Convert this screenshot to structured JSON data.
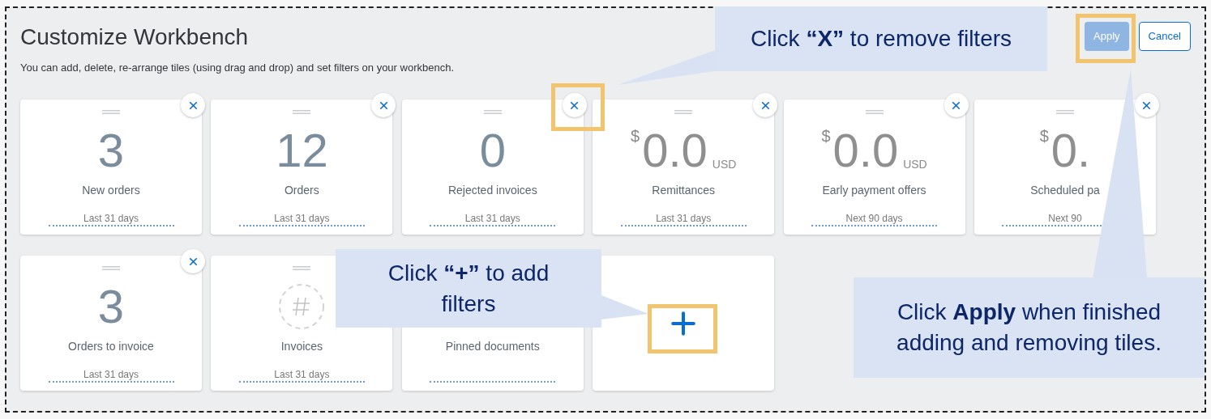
{
  "header": {
    "title": "Customize Workbench",
    "subtitle": "You can add, delete, re-arrange tiles (using drag and drop) and set filters on your workbench."
  },
  "buttons": [
    {
      "label": "Apply",
      "kind": "primary"
    },
    {
      "label": "Cancel",
      "kind": "secondary"
    }
  ],
  "tiles": [
    {
      "kind": "count",
      "value": "3",
      "label": "New orders",
      "period": "Last 31 days",
      "removable": true
    },
    {
      "kind": "count",
      "value": "12",
      "label": "Orders",
      "period": "Last 31 days",
      "removable": true
    },
    {
      "kind": "count",
      "value": "0",
      "label": "Rejected invoices",
      "period": "Last 31 days",
      "removable": true
    },
    {
      "kind": "amount",
      "currency_symbol": "$",
      "value": "0.0",
      "currency": "USD",
      "label": "Remittances",
      "period": "Last 31 days",
      "removable": true
    },
    {
      "kind": "amount",
      "currency_symbol": "$",
      "value": "0.0",
      "currency": "USD",
      "label": "Early payment offers",
      "period": "Next 90 days",
      "removable": true
    },
    {
      "kind": "amount",
      "currency_symbol": "$",
      "value": "0.",
      "label": "Scheduled pa",
      "period": "Next 90",
      "removable": true
    },
    {
      "kind": "count",
      "value": "3",
      "label": "Orders to invoice",
      "period": "Last 31 days",
      "removable": true
    },
    {
      "kind": "placeholder",
      "label": "Invoices",
      "period": "Last 31 days",
      "removable": false
    },
    {
      "kind": "empty",
      "label": "Pinned documents"
    },
    {
      "kind": "add"
    }
  ],
  "callouts": [
    {
      "kind": "remove",
      "text": "Click **“X”** to remove filters"
    },
    {
      "kind": "add",
      "text": "Click **“+”** to add filters"
    },
    {
      "kind": "apply",
      "text": "Click **Apply** when finished adding and removing tiles."
    }
  ]
}
